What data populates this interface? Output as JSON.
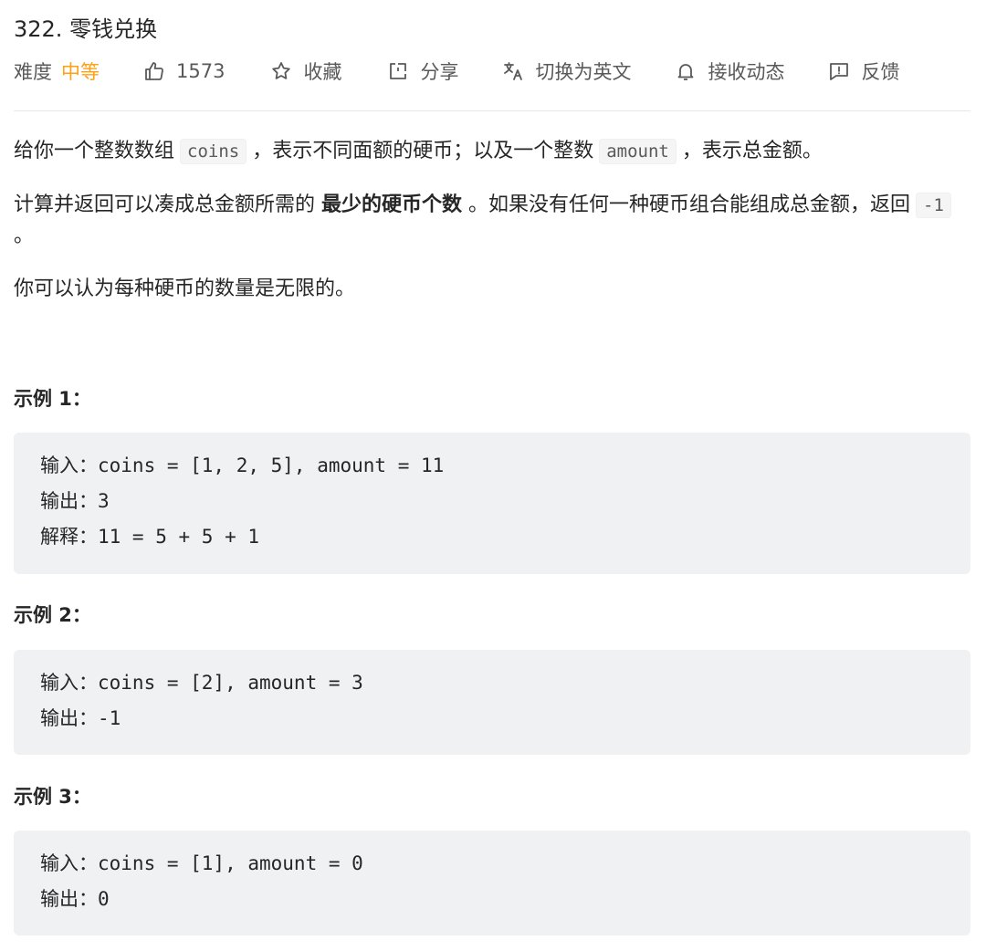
{
  "problem": {
    "title": "322. 零钱兑换",
    "difficulty_label": "难度",
    "difficulty": "中等",
    "likes": "1573",
    "favorite_label": "收藏",
    "share_label": "分享",
    "translate_label": "切换为英文",
    "subscribe_label": "接收动态",
    "feedback_label": "反馈"
  },
  "description": {
    "p1": {
      "t1": "给你一个整数数组",
      "code1": "coins",
      "t2": "，表示不同面额的硬币；以及一个整数",
      "code2": "amount",
      "t3": "，表示总金额。"
    },
    "p2": {
      "t1": "计算并返回可以凑成总金额所需的 ",
      "bold": "最少的硬币个数",
      "t2": " 。如果没有任何一种硬币组合能组成总金额，返回",
      "code": "-1",
      "t3": " 。"
    },
    "p3": "你可以认为每种硬币的数量是无限的。"
  },
  "examples": [
    {
      "title": "示例 1：",
      "lines": [
        "输入：coins = [1, 2, 5], amount = 11",
        "输出：3",
        "解释：11 = 5 + 5 + 1"
      ]
    },
    {
      "title": "示例 2：",
      "lines": [
        "输入：coins = [2], amount = 3",
        "输出：-1"
      ]
    },
    {
      "title": "示例 3：",
      "lines": [
        "输入：coins = [1], amount = 0",
        "输出：0"
      ]
    }
  ],
  "colors": {
    "difficulty_medium": "#ffa116",
    "code_block_bg": "#f0f1f3",
    "meta_text": "#595959"
  },
  "icons": [
    "thumb-up-icon",
    "star-icon",
    "share-icon",
    "translate-icon",
    "bell-icon",
    "feedback-icon"
  ]
}
